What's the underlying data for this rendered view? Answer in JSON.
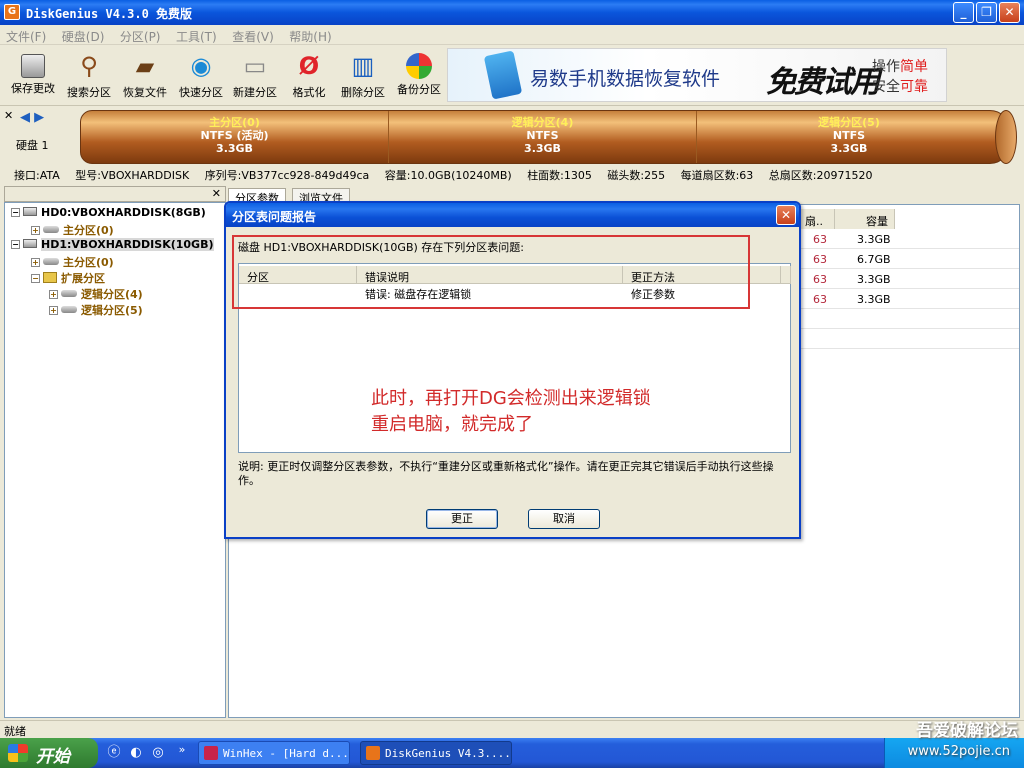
{
  "window": {
    "title": "DiskGenius V4.3.0 免费版",
    "app_icon": "G"
  },
  "menubar": [
    "文件(F)",
    "硬盘(D)",
    "分区(P)",
    "工具(T)",
    "查看(V)",
    "帮助(H)"
  ],
  "toolbar": {
    "buttons": [
      {
        "label": "保存更改",
        "icon": "save-icon"
      },
      {
        "label": "搜索分区",
        "icon": "magnifier-icon"
      },
      {
        "label": "恢复文件",
        "icon": "recover-files-icon"
      },
      {
        "label": "快速分区",
        "icon": "quick-partition-icon"
      },
      {
        "label": "新建分区",
        "icon": "new-partition-icon"
      },
      {
        "label": "格式化",
        "icon": "format-icon"
      },
      {
        "label": "删除分区",
        "icon": "delete-partition-icon"
      },
      {
        "label": "备份分区",
        "icon": "backup-partition-icon"
      }
    ],
    "ad": {
      "text": "易数手机数据恢复软件",
      "trial": "免费试用",
      "line1a": "操作",
      "line1b": "简单",
      "line2a": "安全",
      "line2b": "可靠"
    }
  },
  "diskbar": {
    "disk_label": "硬盘 1",
    "partitions": [
      {
        "name": "主分区(0)",
        "fs": "NTFS (活动)",
        "size": "3.3GB"
      },
      {
        "name": "逻辑分区(4)",
        "fs": "NTFS",
        "size": "3.3GB"
      },
      {
        "name": "逻辑分区(5)",
        "fs": "NTFS",
        "size": "3.3GB"
      }
    ]
  },
  "info": {
    "interface": "接口:ATA",
    "model": "型号:VBOXHARDDISK",
    "serial": "序列号:VB377cc928-849d49ca",
    "capacity": "容量:10.0GB(10240MB)",
    "cylinders": "柱面数:1305",
    "heads": "磁头数:255",
    "sectors_per_track": "每道扇区数:63",
    "total_sectors": "总扇区数:20971520"
  },
  "tree": {
    "nodes": [
      {
        "label": "HD0:VBOXHARDDISK(8GB)",
        "expander": "−"
      },
      {
        "label": "主分区(0)",
        "expander": "+"
      },
      {
        "label": "HD1:VBOXHARDDISK(10GB)",
        "expander": "−"
      },
      {
        "label": "主分区(0)",
        "expander": "+"
      },
      {
        "label": "扩展分区",
        "expander": "−"
      },
      {
        "label": "逻辑分区(4)",
        "expander": "+"
      },
      {
        "label": "逻辑分区(5)",
        "expander": "+"
      }
    ]
  },
  "tabs": [
    "分区参数",
    "浏览文件"
  ],
  "right_table": {
    "headers": [
      "扇..",
      "容量"
    ],
    "rows": [
      {
        "sector": "63",
        "size": "3.3GB"
      },
      {
        "sector": "63",
        "size": "6.7GB"
      },
      {
        "sector": "63",
        "size": "3.3GB"
      },
      {
        "sector": "63",
        "size": "3.3GB"
      }
    ]
  },
  "status": {
    "text": "就绪"
  },
  "dialog": {
    "title": "分区表问题报告",
    "intro": "磁盘 HD1:VBOXHARDDISK(10GB) 存在下列分区表问题:",
    "columns": [
      "分区",
      "错误说明",
      "更正方法"
    ],
    "rows": [
      {
        "partition": "",
        "error": "错误: 磁盘存在逻辑锁",
        "fix": "修正参数"
      }
    ],
    "annotation_line1": "此时，再打开DG会检测出来逻辑锁",
    "annotation_line2": "重启电脑，就完成了",
    "note": "说明: 更正时仅调整分区表参数，不执行“重建分区或重新格式化”操作。请在更正完其它错误后手动执行这些操作。",
    "ok_label": "更正",
    "cancel_label": "取消"
  },
  "taskbar": {
    "start_label": "开始",
    "quick_launch": [
      "ie-icon",
      "media-icon",
      "browser-icon"
    ],
    "overflow": "»",
    "tasks": [
      {
        "label": "WinHex - [Hard d...",
        "icon_color": "#c8244a"
      },
      {
        "label": "DiskGenius V4.3....",
        "icon_color": "#e8741a"
      }
    ],
    "watermark": "吾爱破解论坛",
    "watermark_url": "www.52pojie.cn"
  }
}
